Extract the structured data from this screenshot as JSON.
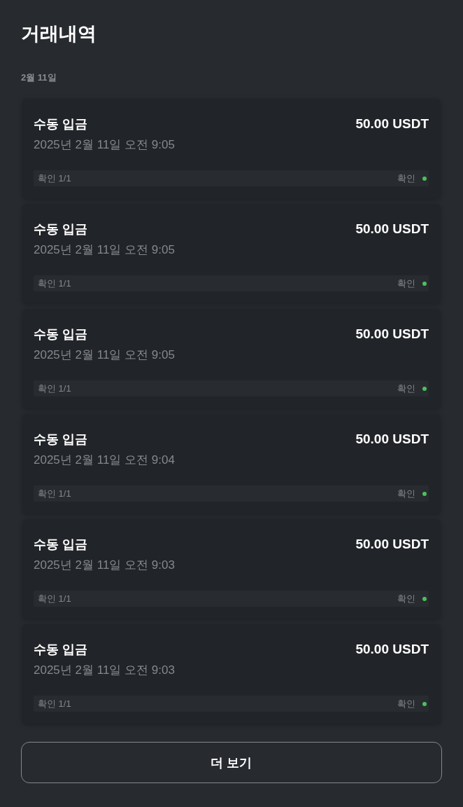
{
  "page": {
    "title": "거래내역"
  },
  "groups": [
    {
      "date": "2월 11일",
      "transactions": [
        {
          "type": "수동 입금",
          "amount": "50.00 USDT",
          "time": "2025년 2월 11일 오전 9:05",
          "confirmations": "확인 1/1",
          "status": {
            "label": "확인",
            "color": "#4cc15a"
          }
        },
        {
          "type": "수동 입금",
          "amount": "50.00 USDT",
          "time": "2025년 2월 11일 오전 9:05",
          "confirmations": "확인 1/1",
          "status": {
            "label": "확인",
            "color": "#4cc15a"
          }
        },
        {
          "type": "수동 입금",
          "amount": "50.00 USDT",
          "time": "2025년 2월 11일 오전 9:05",
          "confirmations": "확인 1/1",
          "status": {
            "label": "확인",
            "color": "#4cc15a"
          }
        },
        {
          "type": "수동 입금",
          "amount": "50.00 USDT",
          "time": "2025년 2월 11일 오전 9:04",
          "confirmations": "확인 1/1",
          "status": {
            "label": "확인",
            "color": "#4cc15a"
          }
        },
        {
          "type": "수동 입금",
          "amount": "50.00 USDT",
          "time": "2025년 2월 11일 오전 9:03",
          "confirmations": "확인 1/1",
          "status": {
            "label": "확인",
            "color": "#4cc15a"
          }
        },
        {
          "type": "수동 입금",
          "amount": "50.00 USDT",
          "time": "2025년 2월 11일 오전 9:03",
          "confirmations": "확인 1/1",
          "status": {
            "label": "확인",
            "color": "#4cc15a"
          }
        }
      ]
    }
  ],
  "more_button": {
    "label": "더 보기"
  }
}
